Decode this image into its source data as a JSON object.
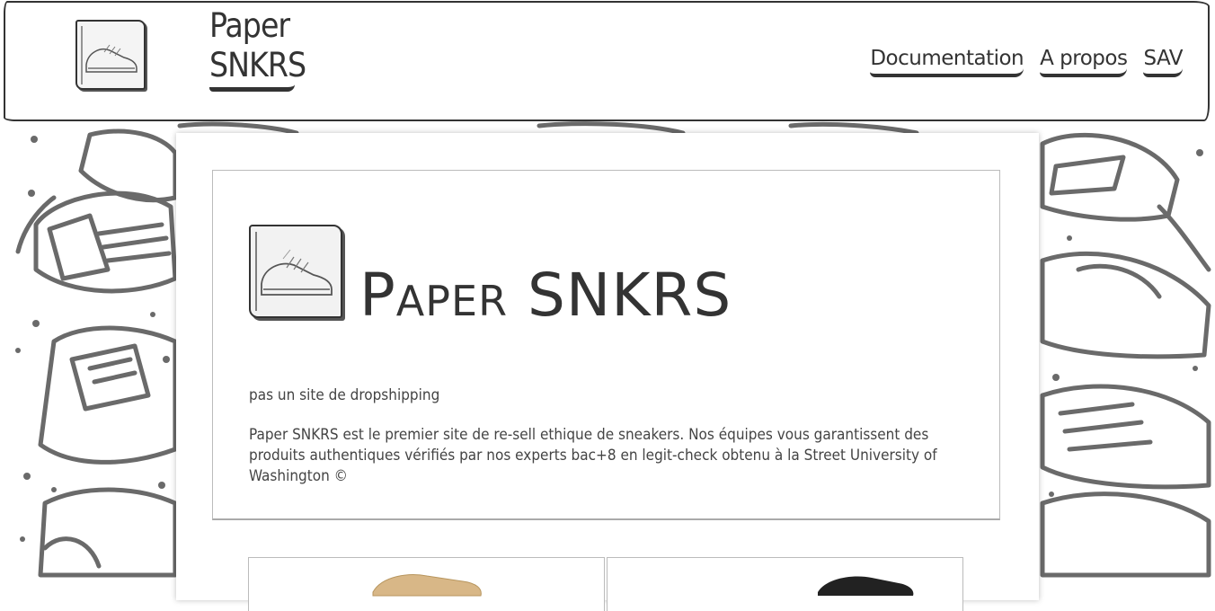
{
  "navbar": {
    "brand_line1": "Paper",
    "brand_line2": "SNKRS",
    "links": [
      {
        "label": "Documentation"
      },
      {
        "label": "A propos"
      },
      {
        "label": "SAV"
      }
    ]
  },
  "hero": {
    "title": "Paper SNKRS",
    "tagline": "pas un site de dropshipping",
    "description": "Paper SNKRS est le premier site de re-sell ethique de sneakers. Nos équipes vous garantissent des produits authentiques vérifiés par nos experts bac+8 en legit-check obtenu à la Street University of Washington ©"
  },
  "products": [
    {
      "icon": "sneaker-tan-icon",
      "color": "#d8b787"
    },
    {
      "icon": "sneaker-black-icon",
      "color": "#222222"
    }
  ],
  "colors": {
    "ink": "#333333",
    "paper": "#ffffff"
  }
}
